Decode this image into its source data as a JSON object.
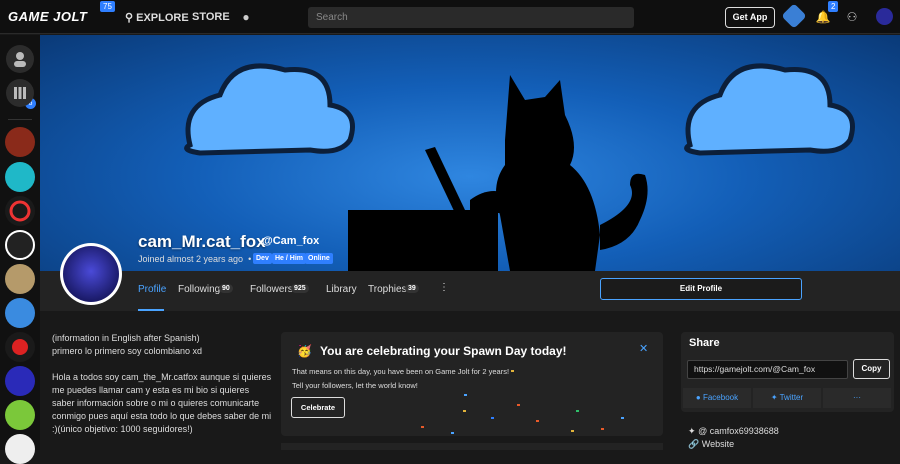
{
  "topbar": {
    "logo": "GAME JOLT",
    "logo_badge": "75",
    "explore": "EXPLORE",
    "store": "STORE",
    "search_placeholder": "Search",
    "get_app": "Get App",
    "notif_badge": "2"
  },
  "sidebar": {
    "friends_badge": "6"
  },
  "profile": {
    "name": "cam_Mr.cat_fox",
    "handle": "@Cam_fox",
    "joined": "Joined almost 2 years ago",
    "tags": [
      "Dev",
      "He / Him",
      "Online"
    ],
    "tabs": [
      {
        "label": "Profile",
        "count": ""
      },
      {
        "label": "Following",
        "count": "90"
      },
      {
        "label": "Followers",
        "count": "925"
      },
      {
        "label": "Library",
        "count": ""
      },
      {
        "label": "Trophies",
        "count": "39"
      }
    ],
    "edit_profile": "Edit Profile"
  },
  "bio": {
    "line1": "(information in English after Spanish)",
    "line2": "primero lo primero soy colombiano xd",
    "para": "Hola a todos soy cam_the_Mr.catfox aunque si quieres me puedes llamar cam y esta es mi bio  si quieres saber información sobre o mi o quieres comunicarte conmigo pues aquí esta todo lo que debes saber de mi :)(único objetivo: 1000 seguidores!)"
  },
  "spawn": {
    "title": "You are celebrating your Spawn Day today!",
    "text1": "That means on this day, you have been on Game Jolt for 2 years!",
    "text2": "Tell your followers, let the world know!",
    "button": "Celebrate"
  },
  "share": {
    "title": "Share",
    "url": "https://gamejolt.com/@Cam_fox",
    "copy": "Copy",
    "facebook": "Facebook",
    "twitter": "Twitter",
    "more": "···"
  },
  "links": {
    "twitter_handle": "@ camfox69938688",
    "website": "Website"
  },
  "colors": {
    "accent": "#2f7fff",
    "link": "#4aa3ff",
    "banner": "#135fb8"
  }
}
